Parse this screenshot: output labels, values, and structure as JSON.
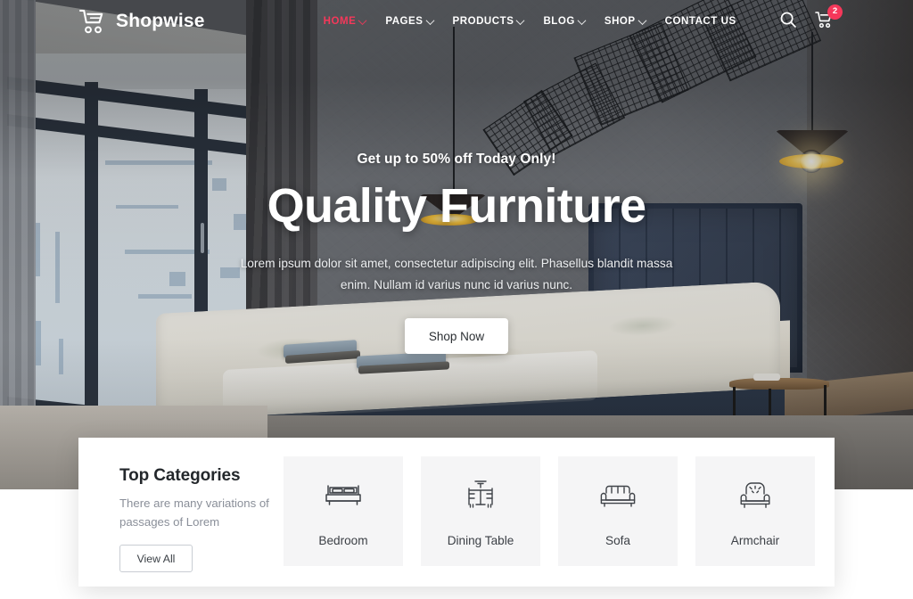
{
  "brand": {
    "name": "Shopwise",
    "logo_icon": "shopping-cart-icon",
    "accent_color": "#f5385a"
  },
  "header": {
    "nav": [
      {
        "label": "HOME",
        "has_dropdown": true,
        "active": true
      },
      {
        "label": "PAGES",
        "has_dropdown": true,
        "active": false
      },
      {
        "label": "PRODUCTS",
        "has_dropdown": true,
        "active": false
      },
      {
        "label": "BLOG",
        "has_dropdown": true,
        "active": false
      },
      {
        "label": "SHOP",
        "has_dropdown": true,
        "active": false
      },
      {
        "label": "CONTACT US",
        "has_dropdown": false,
        "active": false
      }
    ],
    "search_icon": "search-icon",
    "cart_icon": "shopping-cart-icon",
    "cart_count": "2"
  },
  "hero": {
    "eyebrow": "Get up to 50% off Today Only!",
    "title": "Quality Furniture",
    "description": "Lorem ipsum dolor sit amet, consectetur adipiscing elit. Phasellus blandit massa enim. Nullam id varius nunc id varius nunc.",
    "cta_label": "Shop Now",
    "scene": "bedroom interior with blue upholstered bed, large window, pendant lamps and geometric wall decor"
  },
  "categories": {
    "title": "Top Categories",
    "subtitle": "There are many variations of passages of Lorem",
    "view_all_label": "View All",
    "items": [
      {
        "label": "Bedroom",
        "icon": "bed-icon"
      },
      {
        "label": "Dining Table",
        "icon": "dining-table-icon"
      },
      {
        "label": "Sofa",
        "icon": "sofa-icon"
      },
      {
        "label": "Armchair",
        "icon": "armchair-icon"
      }
    ]
  }
}
